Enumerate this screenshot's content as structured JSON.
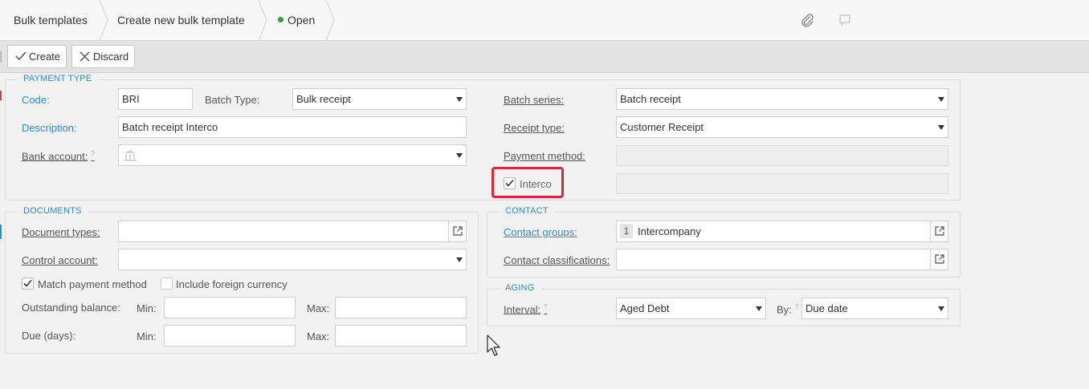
{
  "breadcrumbs": {
    "item1": "Bulk templates",
    "item2": "Create new bulk template",
    "status": "Open"
  },
  "top_icons": {
    "attach": "paperclip-icon",
    "comment": "comment-icon"
  },
  "toolbar": {
    "create_label": "Create",
    "discard_label": "Discard"
  },
  "payment_type": {
    "legend": "PAYMENT TYPE",
    "code_label": "Code:",
    "code_value": "BRI",
    "batch_type_label": "Batch Type:",
    "batch_type_value": "Bulk receipt",
    "description_label": "Description:",
    "description_value": "Batch receipt Interco",
    "bank_account_label": "Bank account:",
    "bank_account_value": "",
    "batch_series_label": "Batch series:",
    "batch_series_value": "Batch receipt",
    "receipt_type_label": "Receipt type:",
    "receipt_type_value": "Customer Receipt",
    "payment_method_label": "Payment method:",
    "payment_method_value": "",
    "interco_label": "Interco",
    "interco_checked": true
  },
  "documents": {
    "legend": "DOCUMENTS",
    "document_types_label": "Document types:",
    "control_account_label": "Control account:",
    "match_payment_label": "Match payment method",
    "match_payment_checked": true,
    "include_foreign_label": "Include foreign currency",
    "include_foreign_checked": false,
    "outstanding_label": "Outstanding balance:",
    "due_days_label": "Due (days):",
    "min_label": "Min:",
    "max_label": "Max:"
  },
  "contact": {
    "legend": "CONTACT",
    "contact_groups_label": "Contact groups:",
    "contact_groups_count": "1",
    "contact_groups_value": "Intercompany",
    "contact_classifications_label": "Contact classifications:"
  },
  "aging": {
    "legend": "AGING",
    "interval_label": "Interval:",
    "interval_value": "Aged Debt",
    "by_label": "By:",
    "by_value": "Due date"
  },
  "colors": {
    "accent": "#2a8fc9",
    "highlight": "#d8283c",
    "status_green": "#3a9a3a"
  }
}
